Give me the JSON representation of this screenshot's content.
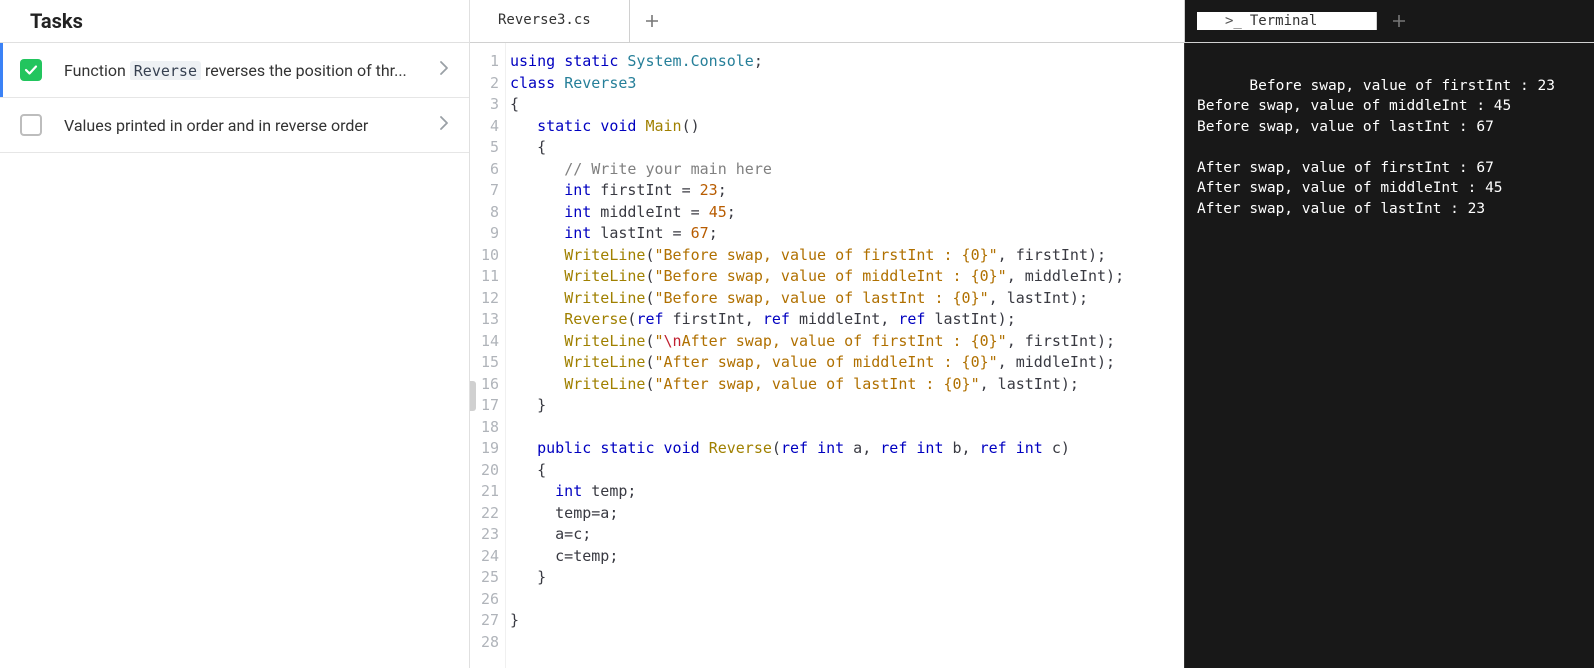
{
  "tasks": {
    "title": "Tasks",
    "items": [
      {
        "checked": true,
        "active": true,
        "pre": "Function ",
        "chip": "Reverse",
        "post": " reverses the position of thr..."
      },
      {
        "checked": false,
        "active": false,
        "text": "Values printed in order and in reverse order"
      }
    ]
  },
  "editor": {
    "tab_label": "Reverse3.cs",
    "line_count": 28,
    "code_lines": [
      [
        [
          "kw",
          "using"
        ],
        [
          "plain",
          " "
        ],
        [
          "kw",
          "static"
        ],
        [
          "plain",
          " "
        ],
        [
          "ns",
          "System.Console"
        ],
        [
          "plain",
          ";"
        ]
      ],
      [
        [
          "kw",
          "class"
        ],
        [
          "plain",
          " "
        ],
        [
          "type",
          "Reverse3"
        ]
      ],
      [
        [
          "plain",
          "{"
        ]
      ],
      [
        [
          "plain",
          "   "
        ],
        [
          "kw",
          "static"
        ],
        [
          "plain",
          " "
        ],
        [
          "kw",
          "void"
        ],
        [
          "plain",
          " "
        ],
        [
          "fn",
          "Main"
        ],
        [
          "plain",
          "()"
        ]
      ],
      [
        [
          "plain",
          "   {"
        ]
      ],
      [
        [
          "plain",
          "      "
        ],
        [
          "cmt",
          "// Write your main here"
        ]
      ],
      [
        [
          "plain",
          "      "
        ],
        [
          "kw",
          "int"
        ],
        [
          "plain",
          " firstInt = "
        ],
        [
          "num",
          "23"
        ],
        [
          "plain",
          ";"
        ]
      ],
      [
        [
          "plain",
          "      "
        ],
        [
          "kw",
          "int"
        ],
        [
          "plain",
          " middleInt = "
        ],
        [
          "num",
          "45"
        ],
        [
          "plain",
          ";"
        ]
      ],
      [
        [
          "plain",
          "      "
        ],
        [
          "kw",
          "int"
        ],
        [
          "plain",
          " lastInt = "
        ],
        [
          "num",
          "67"
        ],
        [
          "plain",
          ";"
        ]
      ],
      [
        [
          "plain",
          "      "
        ],
        [
          "call",
          "WriteLine"
        ],
        [
          "plain",
          "("
        ],
        [
          "str",
          "\"Before swap, value of firstInt : {0}\""
        ],
        [
          "plain",
          ", firstInt);"
        ]
      ],
      [
        [
          "plain",
          "      "
        ],
        [
          "call",
          "WriteLine"
        ],
        [
          "plain",
          "("
        ],
        [
          "str",
          "\"Before swap, value of middleInt : {0}\""
        ],
        [
          "plain",
          ", middleInt);"
        ]
      ],
      [
        [
          "plain",
          "      "
        ],
        [
          "call",
          "WriteLine"
        ],
        [
          "plain",
          "("
        ],
        [
          "str",
          "\"Before swap, value of lastInt : {0}\""
        ],
        [
          "plain",
          ", lastInt);"
        ]
      ],
      [
        [
          "plain",
          "      "
        ],
        [
          "call",
          "Reverse"
        ],
        [
          "plain",
          "("
        ],
        [
          "kw",
          "ref"
        ],
        [
          "plain",
          " firstInt, "
        ],
        [
          "kw",
          "ref"
        ],
        [
          "plain",
          " middleInt, "
        ],
        [
          "kw",
          "ref"
        ],
        [
          "plain",
          " lastInt);"
        ]
      ],
      [
        [
          "plain",
          "      "
        ],
        [
          "call",
          "WriteLine"
        ],
        [
          "plain",
          "("
        ],
        [
          "str",
          "\""
        ],
        [
          "esc",
          "\\n"
        ],
        [
          "str",
          "After swap, value of firstInt : {0}\""
        ],
        [
          "plain",
          ", firstInt);"
        ]
      ],
      [
        [
          "plain",
          "      "
        ],
        [
          "call",
          "WriteLine"
        ],
        [
          "plain",
          "("
        ],
        [
          "str",
          "\"After swap, value of middleInt : {0}\""
        ],
        [
          "plain",
          ", middleInt);"
        ]
      ],
      [
        [
          "plain",
          "      "
        ],
        [
          "call",
          "WriteLine"
        ],
        [
          "plain",
          "("
        ],
        [
          "str",
          "\"After swap, value of lastInt : {0}\""
        ],
        [
          "plain",
          ", lastInt);"
        ]
      ],
      [
        [
          "plain",
          "   }"
        ]
      ],
      [
        [
          "plain",
          ""
        ]
      ],
      [
        [
          "plain",
          "   "
        ],
        [
          "kw",
          "public"
        ],
        [
          "plain",
          " "
        ],
        [
          "kw",
          "static"
        ],
        [
          "plain",
          " "
        ],
        [
          "kw",
          "void"
        ],
        [
          "plain",
          " "
        ],
        [
          "fn",
          "Reverse"
        ],
        [
          "plain",
          "("
        ],
        [
          "kw",
          "ref"
        ],
        [
          "plain",
          " "
        ],
        [
          "kw",
          "int"
        ],
        [
          "plain",
          " a, "
        ],
        [
          "kw",
          "ref"
        ],
        [
          "plain",
          " "
        ],
        [
          "kw",
          "int"
        ],
        [
          "plain",
          " b, "
        ],
        [
          "kw",
          "ref"
        ],
        [
          "plain",
          " "
        ],
        [
          "kw",
          "int"
        ],
        [
          "plain",
          " c)"
        ]
      ],
      [
        [
          "plain",
          "   {"
        ]
      ],
      [
        [
          "plain",
          "     "
        ],
        [
          "kw",
          "int"
        ],
        [
          "plain",
          " temp;"
        ]
      ],
      [
        [
          "plain",
          "     temp=a;"
        ]
      ],
      [
        [
          "plain",
          "     a=c;"
        ]
      ],
      [
        [
          "plain",
          "     c=temp;"
        ]
      ],
      [
        [
          "plain",
          "   }"
        ]
      ],
      [
        [
          "plain",
          ""
        ]
      ],
      [
        [
          "plain",
          "}"
        ]
      ],
      [
        [
          "plain",
          ""
        ]
      ]
    ]
  },
  "terminal": {
    "tab_label": "Terminal",
    "output": "Before swap, value of firstInt : 23\nBefore swap, value of middleInt : 45\nBefore swap, value of lastInt : 67\n\nAfter swap, value of firstInt : 67\nAfter swap, value of middleInt : 45\nAfter swap, value of lastInt : 23"
  }
}
